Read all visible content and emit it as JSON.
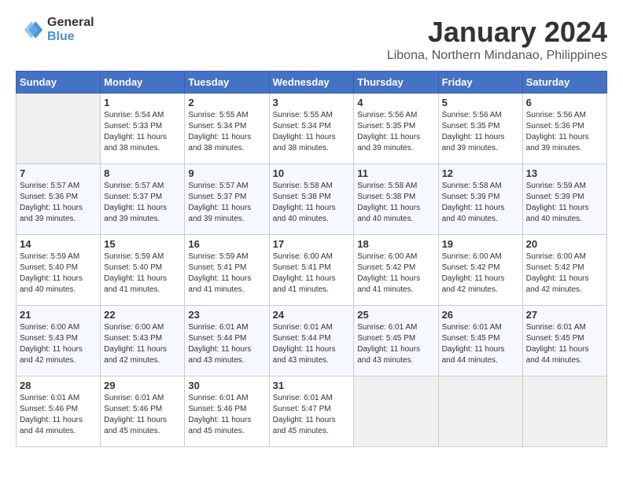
{
  "header": {
    "logo_line1": "General",
    "logo_line2": "Blue",
    "title": "January 2024",
    "subtitle": "Libona, Northern Mindanao, Philippines"
  },
  "weekdays": [
    "Sunday",
    "Monday",
    "Tuesday",
    "Wednesday",
    "Thursday",
    "Friday",
    "Saturday"
  ],
  "weeks": [
    [
      {
        "day": "",
        "sunrise": "",
        "sunset": "",
        "daylight": "",
        "empty": true
      },
      {
        "day": "1",
        "sunrise": "Sunrise: 5:54 AM",
        "sunset": "Sunset: 5:33 PM",
        "daylight": "Daylight: 11 hours and 38 minutes."
      },
      {
        "day": "2",
        "sunrise": "Sunrise: 5:55 AM",
        "sunset": "Sunset: 5:34 PM",
        "daylight": "Daylight: 11 hours and 38 minutes."
      },
      {
        "day": "3",
        "sunrise": "Sunrise: 5:55 AM",
        "sunset": "Sunset: 5:34 PM",
        "daylight": "Daylight: 11 hours and 38 minutes."
      },
      {
        "day": "4",
        "sunrise": "Sunrise: 5:56 AM",
        "sunset": "Sunset: 5:35 PM",
        "daylight": "Daylight: 11 hours and 39 minutes."
      },
      {
        "day": "5",
        "sunrise": "Sunrise: 5:56 AM",
        "sunset": "Sunset: 5:35 PM",
        "daylight": "Daylight: 11 hours and 39 minutes."
      },
      {
        "day": "6",
        "sunrise": "Sunrise: 5:56 AM",
        "sunset": "Sunset: 5:36 PM",
        "daylight": "Daylight: 11 hours and 39 minutes."
      }
    ],
    [
      {
        "day": "7",
        "sunrise": "Sunrise: 5:57 AM",
        "sunset": "Sunset: 5:36 PM",
        "daylight": "Daylight: 11 hours and 39 minutes."
      },
      {
        "day": "8",
        "sunrise": "Sunrise: 5:57 AM",
        "sunset": "Sunset: 5:37 PM",
        "daylight": "Daylight: 11 hours and 39 minutes."
      },
      {
        "day": "9",
        "sunrise": "Sunrise: 5:57 AM",
        "sunset": "Sunset: 5:37 PM",
        "daylight": "Daylight: 11 hours and 39 minutes."
      },
      {
        "day": "10",
        "sunrise": "Sunrise: 5:58 AM",
        "sunset": "Sunset: 5:38 PM",
        "daylight": "Daylight: 11 hours and 40 minutes."
      },
      {
        "day": "11",
        "sunrise": "Sunrise: 5:58 AM",
        "sunset": "Sunset: 5:38 PM",
        "daylight": "Daylight: 11 hours and 40 minutes."
      },
      {
        "day": "12",
        "sunrise": "Sunrise: 5:58 AM",
        "sunset": "Sunset: 5:39 PM",
        "daylight": "Daylight: 11 hours and 40 minutes."
      },
      {
        "day": "13",
        "sunrise": "Sunrise: 5:59 AM",
        "sunset": "Sunset: 5:39 PM",
        "daylight": "Daylight: 11 hours and 40 minutes."
      }
    ],
    [
      {
        "day": "14",
        "sunrise": "Sunrise: 5:59 AM",
        "sunset": "Sunset: 5:40 PM",
        "daylight": "Daylight: 11 hours and 40 minutes."
      },
      {
        "day": "15",
        "sunrise": "Sunrise: 5:59 AM",
        "sunset": "Sunset: 5:40 PM",
        "daylight": "Daylight: 11 hours and 41 minutes."
      },
      {
        "day": "16",
        "sunrise": "Sunrise: 5:59 AM",
        "sunset": "Sunset: 5:41 PM",
        "daylight": "Daylight: 11 hours and 41 minutes."
      },
      {
        "day": "17",
        "sunrise": "Sunrise: 6:00 AM",
        "sunset": "Sunset: 5:41 PM",
        "daylight": "Daylight: 11 hours and 41 minutes."
      },
      {
        "day": "18",
        "sunrise": "Sunrise: 6:00 AM",
        "sunset": "Sunset: 5:42 PM",
        "daylight": "Daylight: 11 hours and 41 minutes."
      },
      {
        "day": "19",
        "sunrise": "Sunrise: 6:00 AM",
        "sunset": "Sunset: 5:42 PM",
        "daylight": "Daylight: 11 hours and 42 minutes."
      },
      {
        "day": "20",
        "sunrise": "Sunrise: 6:00 AM",
        "sunset": "Sunset: 5:42 PM",
        "daylight": "Daylight: 11 hours and 42 minutes."
      }
    ],
    [
      {
        "day": "21",
        "sunrise": "Sunrise: 6:00 AM",
        "sunset": "Sunset: 5:43 PM",
        "daylight": "Daylight: 11 hours and 42 minutes."
      },
      {
        "day": "22",
        "sunrise": "Sunrise: 6:00 AM",
        "sunset": "Sunset: 5:43 PM",
        "daylight": "Daylight: 11 hours and 42 minutes."
      },
      {
        "day": "23",
        "sunrise": "Sunrise: 6:01 AM",
        "sunset": "Sunset: 5:44 PM",
        "daylight": "Daylight: 11 hours and 43 minutes."
      },
      {
        "day": "24",
        "sunrise": "Sunrise: 6:01 AM",
        "sunset": "Sunset: 5:44 PM",
        "daylight": "Daylight: 11 hours and 43 minutes."
      },
      {
        "day": "25",
        "sunrise": "Sunrise: 6:01 AM",
        "sunset": "Sunset: 5:45 PM",
        "daylight": "Daylight: 11 hours and 43 minutes."
      },
      {
        "day": "26",
        "sunrise": "Sunrise: 6:01 AM",
        "sunset": "Sunset: 5:45 PM",
        "daylight": "Daylight: 11 hours and 44 minutes."
      },
      {
        "day": "27",
        "sunrise": "Sunrise: 6:01 AM",
        "sunset": "Sunset: 5:45 PM",
        "daylight": "Daylight: 11 hours and 44 minutes."
      }
    ],
    [
      {
        "day": "28",
        "sunrise": "Sunrise: 6:01 AM",
        "sunset": "Sunset: 5:46 PM",
        "daylight": "Daylight: 11 hours and 44 minutes."
      },
      {
        "day": "29",
        "sunrise": "Sunrise: 6:01 AM",
        "sunset": "Sunset: 5:46 PM",
        "daylight": "Daylight: 11 hours and 45 minutes."
      },
      {
        "day": "30",
        "sunrise": "Sunrise: 6:01 AM",
        "sunset": "Sunset: 5:46 PM",
        "daylight": "Daylight: 11 hours and 45 minutes."
      },
      {
        "day": "31",
        "sunrise": "Sunrise: 6:01 AM",
        "sunset": "Sunset: 5:47 PM",
        "daylight": "Daylight: 11 hours and 45 minutes."
      },
      {
        "day": "",
        "sunrise": "",
        "sunset": "",
        "daylight": "",
        "empty": true
      },
      {
        "day": "",
        "sunrise": "",
        "sunset": "",
        "daylight": "",
        "empty": true
      },
      {
        "day": "",
        "sunrise": "",
        "sunset": "",
        "daylight": "",
        "empty": true
      }
    ]
  ]
}
